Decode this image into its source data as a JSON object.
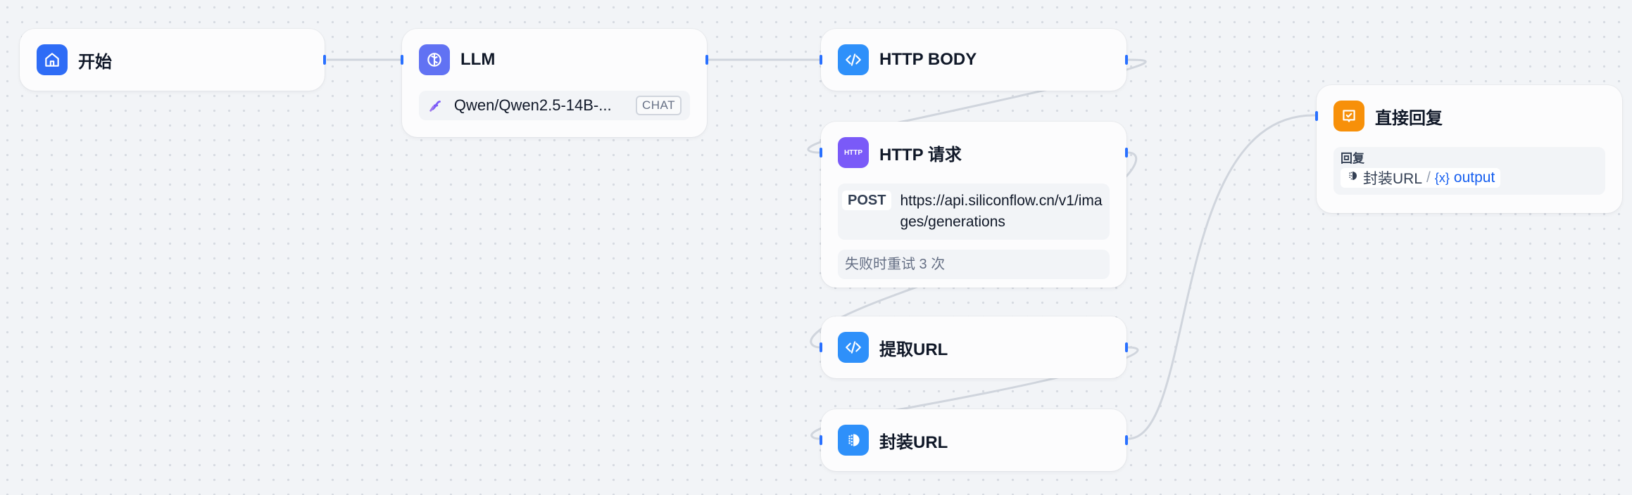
{
  "colors": {
    "canvas": "#f2f4f7",
    "edge": "#d0d5dd",
    "handle": "#2970ff",
    "start_icon": "#2e6cf6",
    "llm_icon": "#6172f3",
    "code_icon": "#2e90fa",
    "http_icon": "#7a5af8",
    "answer_icon": "#f79009",
    "variable": "#155eef"
  },
  "nodes": {
    "start": {
      "title": "开始",
      "icon": "home-icon"
    },
    "llm": {
      "title": "LLM",
      "icon": "llm-brain-icon",
      "model": "Qwen/Qwen2.5-14B-...",
      "model_icon": "siliconflow-logo-icon",
      "mode_badge": "CHAT"
    },
    "http_body": {
      "title": "HTTP BODY",
      "icon": "code-icon"
    },
    "http_request": {
      "title": "HTTP 请求",
      "icon_text": "HTTP",
      "method": "POST",
      "url": "https://api.siliconflow.cn/v1/images/generations",
      "retry": "失败时重试 3 次"
    },
    "extract_url": {
      "title": "提取URL",
      "icon": "code-icon"
    },
    "wrap_url": {
      "title": "封装URL",
      "icon": "template-icon"
    },
    "answer": {
      "title": "直接回复",
      "icon": "answer-icon",
      "label": "回复",
      "var_node": "封装URL",
      "var_sep": "/",
      "var_icon": "{x}",
      "var_name": "output"
    }
  }
}
